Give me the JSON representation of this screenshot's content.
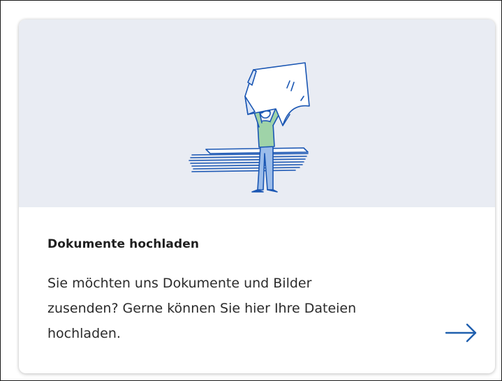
{
  "card": {
    "title": "Dokumente hochladen",
    "description": "Sie möchten uns Dokumente und Bilder zusenden? Gerne können Sie hier Ihre Dateien hochladen.",
    "arrow_icon": "arrow-right-icon",
    "illustration": "person-holding-document-illustration"
  },
  "colors": {
    "hero_background": "#e9ecf3",
    "accent": "#1f5fae",
    "line_art": "#1a56b3",
    "shirt": "#9fd3a8",
    "text": "#1f1f1f"
  }
}
